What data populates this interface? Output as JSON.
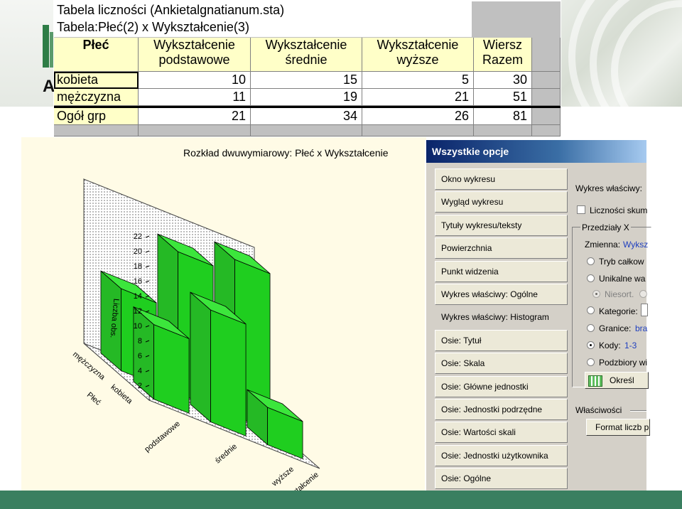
{
  "spreadsheet": {
    "title_line1": "Tabela liczności (Ankietalgnatianum.sta)",
    "title_line2": "Tabela:Płeć(2) x Wykształcenie(3)",
    "headers": [
      {
        "line1": "Płeć",
        "line2": ""
      },
      {
        "line1": "Wykształcenie",
        "line2": "podstawowe"
      },
      {
        "line1": "Wykształcenie",
        "line2": "średnie"
      },
      {
        "line1": "Wykształcenie",
        "line2": "wyższe"
      },
      {
        "line1": "Wiersz",
        "line2": "Razem"
      }
    ],
    "rows": [
      {
        "label": "kobieta",
        "values": [
          "10",
          "15",
          "5",
          "30"
        ]
      },
      {
        "label": "mężczyzna",
        "values": [
          "11",
          "19",
          "21",
          "51"
        ]
      },
      {
        "label": "Ogół grp",
        "values": [
          "21",
          "34",
          "26",
          "81"
        ]
      }
    ]
  },
  "chart": {
    "title": "Rozkład dwuwymiarowy: Płeć x Wykształcenie",
    "z_label": "Liczba obs.",
    "z_ticks": [
      "2",
      "4",
      "6",
      "8",
      "10",
      "12",
      "14",
      "16",
      "18",
      "20",
      "22"
    ],
    "depth_axis_label": "Płeć",
    "depth_ticks": [
      "mężczyzna",
      "kobieta"
    ],
    "x_axis_label": "Wykształcenie",
    "x_ticks": [
      "podstawowe",
      "średnie",
      "wyższe"
    ]
  },
  "chart_data": {
    "type": "bar",
    "title": "Rozkład dwuwymiarowy: Płeć x Wykształcenie",
    "zlabel": "Liczba obs.",
    "categories": [
      "podstawowe",
      "średnie",
      "wyższe"
    ],
    "series": [
      {
        "name": "kobieta",
        "values": [
          10,
          15,
          5
        ]
      },
      {
        "name": "mężczyzna",
        "values": [
          11,
          19,
          21
        ]
      }
    ],
    "zlim": [
      0,
      22
    ],
    "color": "#22dd22"
  },
  "dialog": {
    "title": "Wszystkie opcje",
    "tabs": [
      "Okno wykresu",
      "Wygląd wykresu",
      "Tytuły wykresu/teksty",
      "Powierzchnia",
      "Punkt widzenia",
      "Wykres właściwy: Ogólne",
      "Wykres właściwy: Histogram",
      "Osie: Tytuł",
      "Osie: Skala",
      "Osie: Główne jednostki",
      "Osie: Jednostki podrzędne",
      "Osie: Wartości skali",
      "Osie: Jednostki użytkownika",
      "Osie: Ogólne"
    ],
    "active_tab": "Wykres właściwy: Histogram",
    "panel": {
      "chart_type_label": "Wykres właściwy:",
      "cumulative_label": "Liczności skum",
      "group_intervals": "Przedziały X",
      "variable_label": "Zmienna:",
      "variable_value": "Wyksz",
      "radio_full": "Tryb całkow",
      "radio_unique": "Unikalne wa",
      "radio_unsorted": "Niesort.",
      "radio_categories": "Kategorie:",
      "radio_bounds": "Granice:",
      "bounds_value": "bra",
      "radio_codes": "Kody:",
      "codes_value": "1-3",
      "radio_subsets": "Podzbiory wi",
      "specify_button": "Określ",
      "properties_label": "Właściwości",
      "format_button": "Format liczb p"
    }
  }
}
